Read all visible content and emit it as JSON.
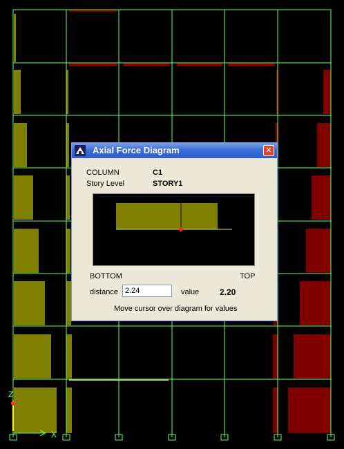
{
  "dialog": {
    "title": "Axial Force Diagram",
    "close_glyph": "✕",
    "column_label": "COLUMN",
    "column_value": "C1",
    "story_label": "Story Level",
    "story_value": "STORY1",
    "bottom_label": "BOTTOM",
    "top_label": "TOP",
    "distance_label": "distance",
    "distance_value": "2.24",
    "value_label": "value",
    "value_value": "2.20",
    "hint": "Move cursor over diagram for values"
  },
  "axes": {
    "z_label": "Z",
    "x_label": "X"
  },
  "colors": {
    "grid": "#66ff66",
    "beam_red": "#cc3300",
    "beam_yellow": "#cccc33",
    "tension_fill": "#808000",
    "compression_fill": "#800000"
  }
}
